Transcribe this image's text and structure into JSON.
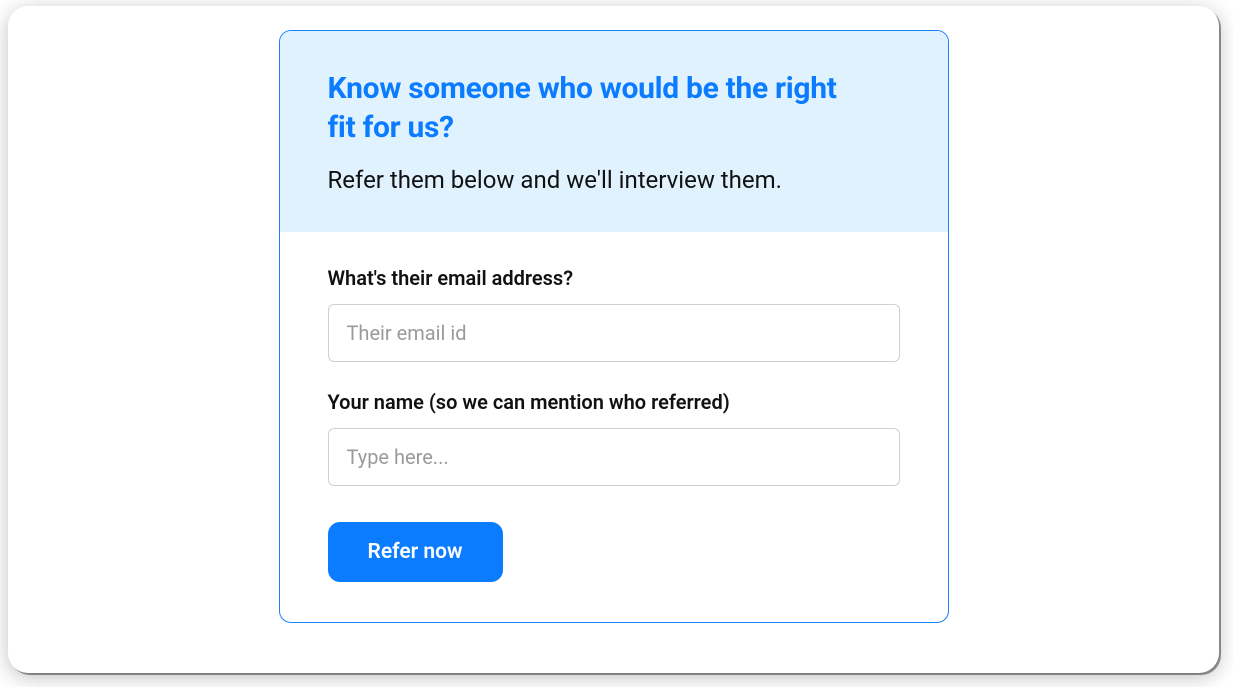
{
  "header": {
    "title": "Know someone who would be the right fit for us?",
    "subtitle": "Refer them below and we'll interview them."
  },
  "fields": {
    "email": {
      "label": "What's their email address?",
      "placeholder": "Their email id"
    },
    "referrer": {
      "label": "Your name (so we can mention who referred)",
      "placeholder": "Type here..."
    }
  },
  "submit": {
    "label": "Refer now"
  }
}
